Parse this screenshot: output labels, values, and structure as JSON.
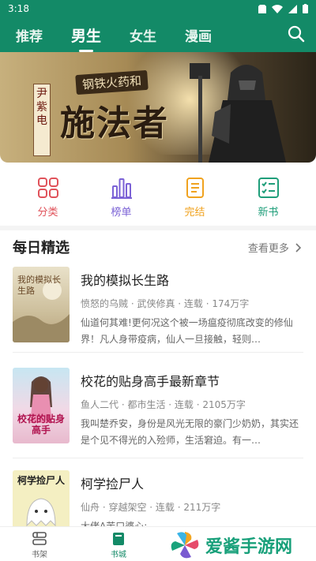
{
  "status": {
    "time": "3:18"
  },
  "tabs": [
    {
      "label": "推荐",
      "active": false
    },
    {
      "label": "男生",
      "active": true
    },
    {
      "label": "女生",
      "active": false
    },
    {
      "label": "漫画",
      "active": false
    }
  ],
  "banner": {
    "subtitle": "钢铁火药和",
    "title": "施法者",
    "author": "尹紫电",
    "slide_count": 3,
    "active_slide": 1
  },
  "categories": [
    {
      "label": "分类",
      "icon": "grid-icon",
      "color": "#e0525a"
    },
    {
      "label": "榜单",
      "icon": "bar-chart-icon",
      "color": "#7b62d6"
    },
    {
      "label": "完结",
      "icon": "document-icon",
      "color": "#f0a21e"
    },
    {
      "label": "新书",
      "icon": "checklist-icon",
      "color": "#1f9e7a"
    }
  ],
  "daily": {
    "title": "每日精选",
    "more": "查看更多"
  },
  "books": [
    {
      "title": "我的模拟长生路",
      "meta": "愤怒的乌贼 · 武侠修真 · 连载 · 174万字",
      "desc": "仙道何其难!更何况这个被一场瘟疫彻底改变的修仙界！凡人身带疫病，仙人一旦接触，轻则…",
      "cover_text": "我的模拟长生路"
    },
    {
      "title": "校花的贴身高手最新章节",
      "meta": "鱼人二代 · 都市生活 · 连载 · 2105万字",
      "desc": "我叫楚乔安，身份是风光无限的豪门少奶奶，其实还是个见不得光的入殓师，生活窘迫。有一…",
      "cover_text": "校花的贴身高手"
    },
    {
      "title": "柯学捡尸人",
      "meta": "仙舟 · 穿越架空 · 连载 · 211万字",
      "desc": "大佬A苦口婆心:",
      "cover_text": "柯学捡尸人"
    }
  ],
  "bottom_nav": [
    {
      "label": "书架",
      "icon": "bookshelf-icon",
      "active": false
    },
    {
      "label": "书城",
      "icon": "book-icon",
      "active": true
    }
  ],
  "watermark": {
    "text": "爱酱手游网"
  },
  "colors": {
    "brand": "#138a67"
  }
}
